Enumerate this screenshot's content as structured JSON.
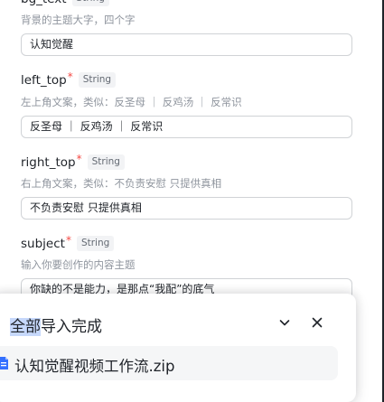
{
  "bg_text_field": {
    "name": "bg_text",
    "type": "String",
    "description": "背景的主题大字，四个字",
    "value": "认知觉醒"
  },
  "left_top_field": {
    "name": "left_top",
    "type": "String",
    "description": "左上角文案，类似：反圣母 ｜ 反鸡汤 ｜ 反常识",
    "value": "反圣母 ｜ 反鸡汤 ｜ 反常识"
  },
  "right_top_field": {
    "name": "right_top",
    "type": "String",
    "description": "右上角文案，类似：不负责安慰 只提供真相",
    "value": "不负责安慰 只提供真相"
  },
  "subject_field": {
    "name": "subject",
    "type": "String",
    "description": "输入你要创作的内容主题",
    "value": "你缺的不是能力，是那点“我配”的底气"
  },
  "required_mark": "*",
  "toast": {
    "title_highlight": "全部",
    "title_rest": "导入完成",
    "file_name": "认知觉醒视频工作流.zip",
    "status_color": "#34c724",
    "icons": [
      "chevron-down-icon",
      "close-icon",
      "file-icon"
    ]
  }
}
